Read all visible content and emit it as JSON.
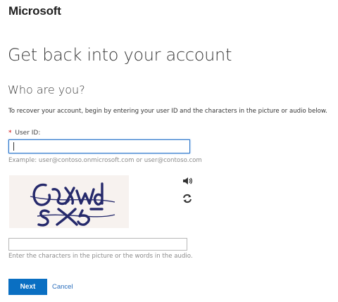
{
  "brand": {
    "name": "Microsoft"
  },
  "page": {
    "title": "Get back into your account",
    "subtitle": "Who are you?",
    "instructions": "To recover your account, begin by entering your user ID and the characters in the picture or audio below."
  },
  "form": {
    "userid_required_mark": "*",
    "userid_label": "User ID:",
    "userid_value": "",
    "userid_example": "Example: user@contoso.onmicrosoft.com or user@contoso.com",
    "captcha_text": "CXWdSX5",
    "captcha_value": "",
    "captcha_hint": "Enter the characters in the picture or the words in the audio.",
    "next_label": "Next",
    "cancel_label": "Cancel"
  },
  "icons": {
    "audio": "speaker-icon",
    "refresh": "refresh-icon"
  },
  "colors": {
    "primary": "#0a6fc2",
    "link": "#2a6ebc",
    "focus_border": "#2a74c9",
    "captcha_ink": "#25296b"
  }
}
